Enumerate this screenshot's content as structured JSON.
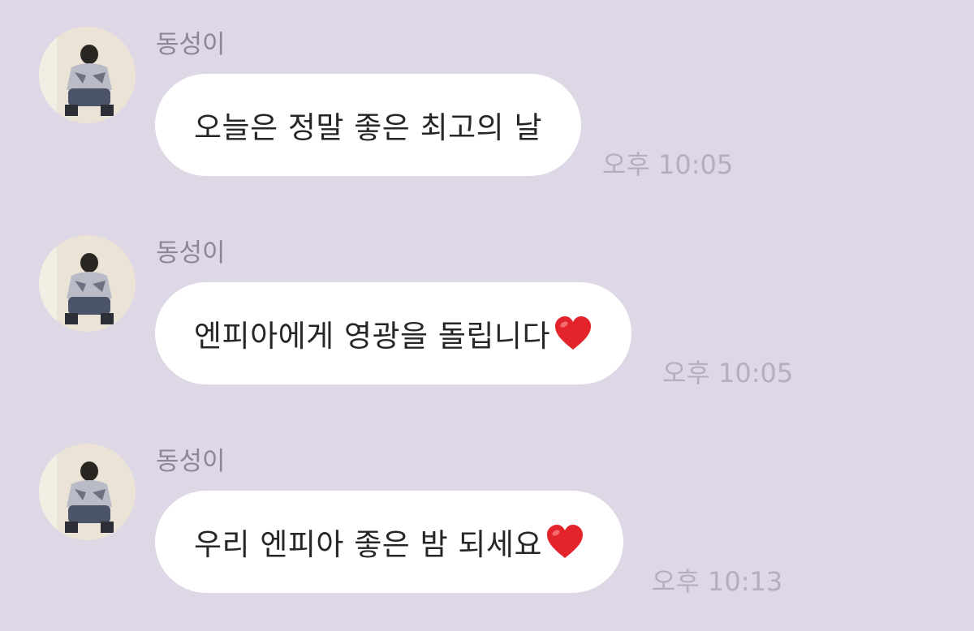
{
  "colors": {
    "background": "#ddd7e6",
    "bubble": "#ffffff",
    "sender_text": "#8b8795",
    "message_text": "#262626",
    "time_text": "#b4afbd",
    "heart": "#e3242b"
  },
  "messages": [
    {
      "sender": "동성이",
      "avatar_icon": "profile-photo",
      "text": "오늘은 정말 좋은 최고의 날",
      "emoji": "",
      "time": "오후 10:05"
    },
    {
      "sender": "동성이",
      "avatar_icon": "profile-photo",
      "text": "엔피아에게 영광을 돌립니다",
      "emoji": "red-heart",
      "time": "오후 10:05"
    },
    {
      "sender": "동성이",
      "avatar_icon": "profile-photo",
      "text": "우리 엔피아 좋은 밤 되세요",
      "emoji": "red-heart",
      "time": "오후 10:13"
    }
  ]
}
